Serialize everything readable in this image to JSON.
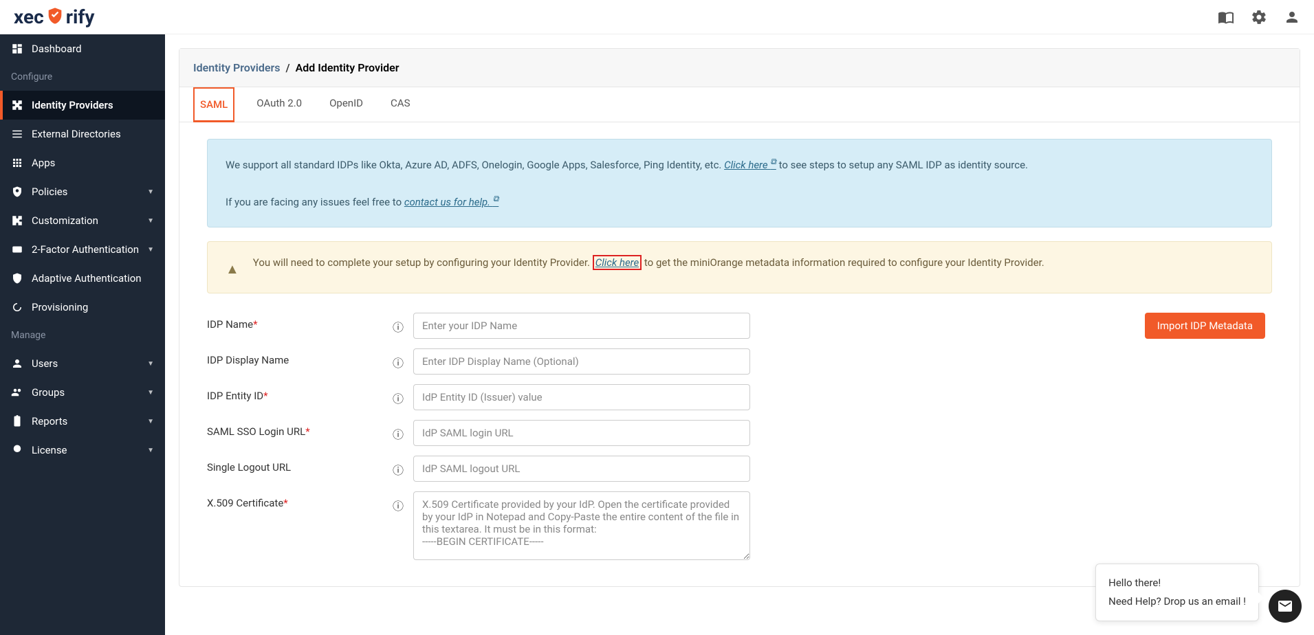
{
  "logo": {
    "part1": "xec",
    "part2": "rify"
  },
  "sidebar": {
    "section_configure": "Configure",
    "section_manage": "Manage",
    "items": {
      "dashboard": "Dashboard",
      "identity_providers": "Identity Providers",
      "external_directories": "External Directories",
      "apps": "Apps",
      "policies": "Policies",
      "customization": "Customization",
      "two_factor": "2-Factor Authentication",
      "adaptive_auth": "Adaptive Authentication",
      "provisioning": "Provisioning",
      "users": "Users",
      "groups": "Groups",
      "reports": "Reports",
      "license": "License"
    }
  },
  "breadcrumb": {
    "parent": "Identity Providers",
    "sep": "/",
    "current": "Add Identity Provider"
  },
  "tabs": {
    "saml": "SAML",
    "oauth": "OAuth 2.0",
    "openid": "OpenID",
    "cas": "CAS"
  },
  "info": {
    "line1_a": "We support all standard IDPs like Okta, Azure AD, ADFS, Onelogin, Google Apps, Salesforce, Ping Identity, etc. ",
    "link1": "Click here",
    "line1_b": " to see steps to setup any SAML IDP as identity source.",
    "line2_a": "If you are facing any issues feel free to ",
    "link2": "contact us for help."
  },
  "warn": {
    "a": "You will need to complete your setup by configuring your Identity Provider. ",
    "link": "Click here",
    "b": " to get the miniOrange metadata information required to configure your Identity Provider."
  },
  "form": {
    "import_btn": "Import IDP Metadata",
    "idp_name": {
      "label": "IDP Name",
      "placeholder": "Enter your IDP Name"
    },
    "idp_display": {
      "label": "IDP Display Name",
      "placeholder": "Enter IDP Display Name (Optional)"
    },
    "idp_entity": {
      "label": "IDP Entity ID",
      "placeholder": "IdP Entity ID (Issuer) value"
    },
    "sso_url": {
      "label": "SAML SSO Login URL",
      "placeholder": "IdP SAML login URL"
    },
    "slo_url": {
      "label": "Single Logout URL",
      "placeholder": "IdP SAML logout URL"
    },
    "cert": {
      "label": "X.509 Certificate",
      "placeholder": "X.509 Certificate provided by your IdP. Open the certificate provided by your IdP in Notepad and Copy-Paste the entire content of the file in this textarea. It must be in this format:\n-----BEGIN CERTIFICATE-----"
    }
  },
  "chat": {
    "line1": "Hello there!",
    "line2": "Need Help? Drop us an email !"
  }
}
